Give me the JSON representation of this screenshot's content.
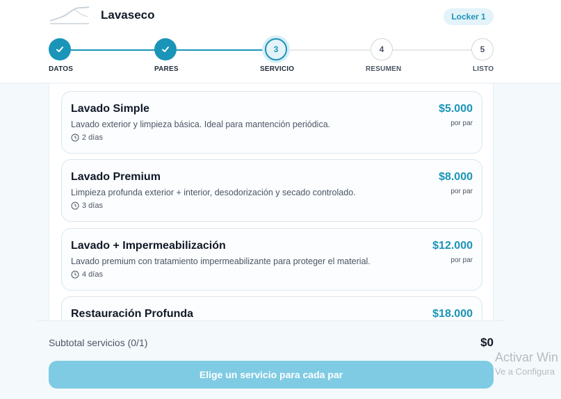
{
  "header": {
    "app_title": "Lavaseco",
    "locker_badge": "Locker 1"
  },
  "stepper": {
    "steps": [
      {
        "number": "1",
        "label": "DATOS",
        "state": "done"
      },
      {
        "number": "2",
        "label": "PARES",
        "state": "done"
      },
      {
        "number": "3",
        "label": "SERVICIO",
        "state": "current"
      },
      {
        "number": "4",
        "label": "RESUMEN",
        "state": "todo"
      },
      {
        "number": "5",
        "label": "LISTO",
        "state": "todo"
      }
    ]
  },
  "services": [
    {
      "name": "Lavado Simple",
      "description": "Lavado exterior y limpieza básica. Ideal para mantención periódica.",
      "duration": "2 días",
      "price": "$5.000",
      "unit": "por par"
    },
    {
      "name": "Lavado Premium",
      "description": "Limpieza profunda exterior + interior, desodorización y secado controlado.",
      "duration": "3 días",
      "price": "$8.000",
      "unit": "por par"
    },
    {
      "name": "Lavado + Impermeabilización",
      "description": "Lavado premium con tratamiento impermeabilizante para proteger el material.",
      "duration": "4 días",
      "price": "$12.000",
      "unit": "por par"
    },
    {
      "name": "Restauración Profunda",
      "description": "",
      "duration": "",
      "price": "$18.000",
      "unit": ""
    }
  ],
  "footer": {
    "subtotal_label": "Subtotal servicios (0/1)",
    "subtotal_value": "$0",
    "cta_label": "Elige un servicio para cada par"
  },
  "watermark": {
    "line1": "Activar Win",
    "line2": "Ve a Configura"
  },
  "colors": {
    "accent": "#1a94b8",
    "cta_disabled": "#7fcbe3",
    "background": "#f4f9fc"
  },
  "icons": {
    "check": "check-icon",
    "clock": "clock-icon"
  }
}
